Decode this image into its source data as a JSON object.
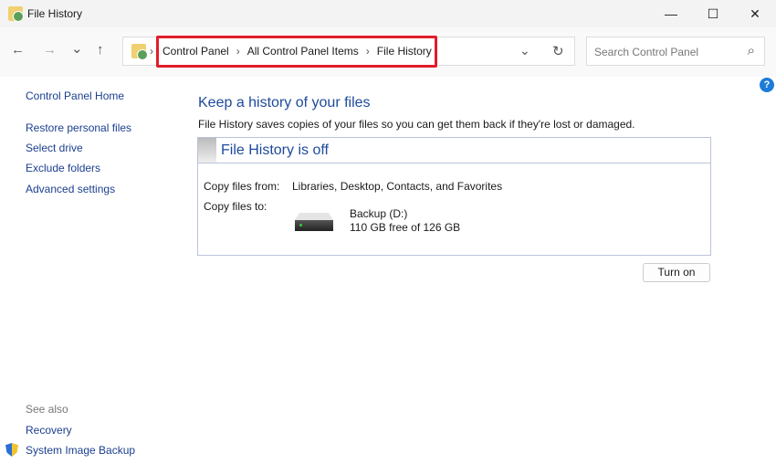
{
  "window": {
    "title": "File History",
    "minimize": "—",
    "maximize": "☐",
    "close": "✕"
  },
  "nav": {
    "back": "←",
    "forward": "→",
    "recent": "⌄",
    "up": "↑",
    "refresh": "↻",
    "dropdown": "⌄",
    "crumb_sep": "›"
  },
  "breadcrumb": [
    "Control Panel",
    "All Control Panel Items",
    "File History"
  ],
  "search": {
    "placeholder": "Search Control Panel",
    "icon": "⌕"
  },
  "sidebar": {
    "home": "Control Panel Home",
    "items": [
      "Restore personal files",
      "Select drive",
      "Exclude folders",
      "Advanced settings"
    ],
    "see_also": "See also",
    "see_also_items": [
      "Recovery",
      "System Image Backup"
    ]
  },
  "main": {
    "heading": "Keep a history of your files",
    "description": "File History saves copies of your files so you can get them back if they're lost or damaged.",
    "status": "File History is off",
    "copy_from_label": "Copy files from:",
    "copy_from_value": "Libraries, Desktop, Contacts, and Favorites",
    "copy_to_label": "Copy files to:",
    "drive_name": "Backup (D:)",
    "drive_space": "110 GB free of 126 GB",
    "turn_on": "Turn on",
    "help": "?"
  }
}
